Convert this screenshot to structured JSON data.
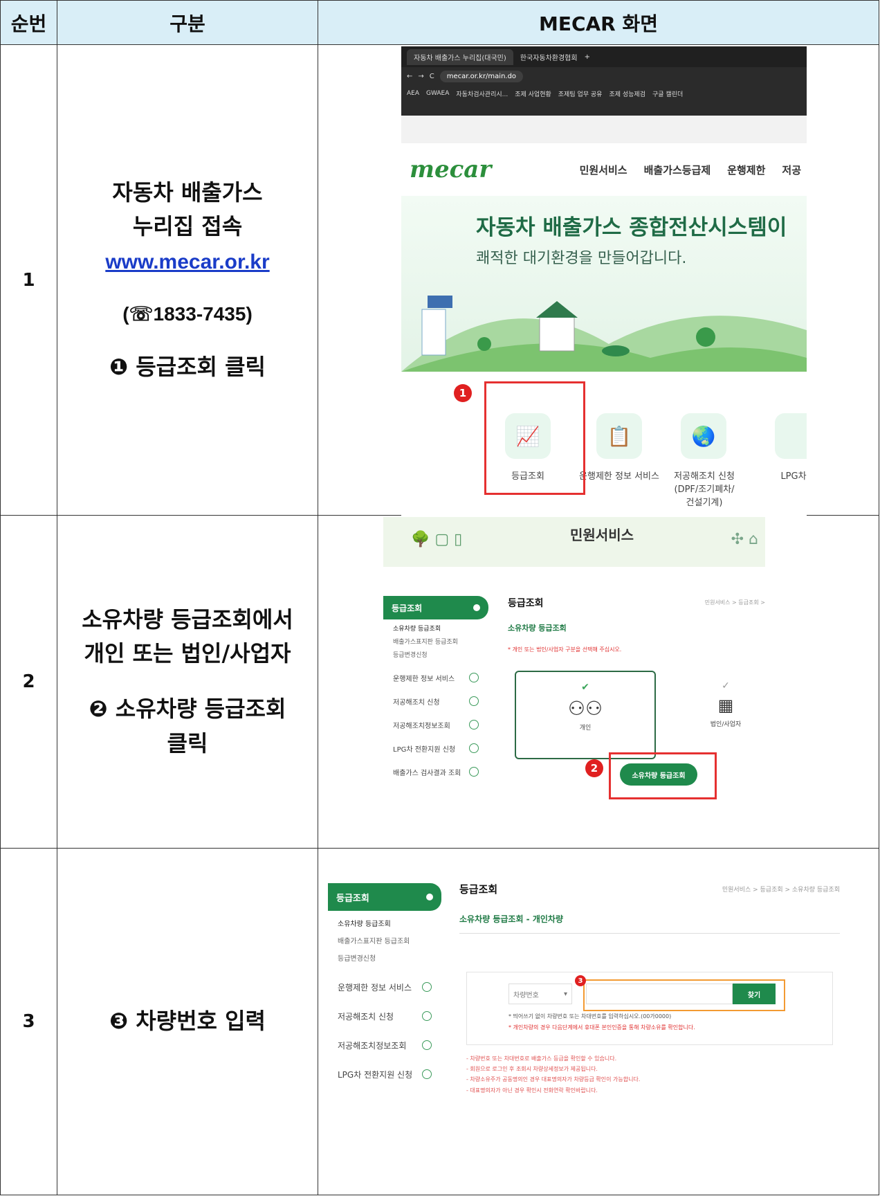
{
  "table": {
    "headers": [
      "순번",
      "구분",
      "MECAR 화면"
    ]
  },
  "rows": [
    {
      "num": "1",
      "line1": "자동차 배출가스",
      "line2": "누리집 접속",
      "link": "www.mecar.or.kr",
      "phone": "(☏1833-7435)",
      "step": "❶ 등급조회 클릭"
    },
    {
      "num": "2",
      "line1": "소유차량 등급조회에서",
      "line2": "개인 또는 법인/사업자",
      "step1": "❷ 소유차량 등급조회",
      "step2": "클릭"
    },
    {
      "num": "3",
      "step": "❸ 차량번호 입력"
    }
  ],
  "shot1": {
    "tab1": "자동차 배출가스 누리집(대국민)",
    "tab2": "한국자동차환경협회",
    "url": "mecar.or.kr/main.do",
    "bookmarks": [
      "AEA",
      "GWAEA",
      "자동차검사관리시...",
      "조제 사업현황",
      "조제팀 업무 공유",
      "조제 성능제검",
      "구글 캘린더"
    ],
    "logo": "mecar",
    "nav": [
      "민원서비스",
      "배출가스등급제",
      "운행제한",
      "저공"
    ],
    "hero_title": "자동차 배출가스 종합전산시스템이",
    "hero_sub": "쾌적한 대기환경을 만들어갑니다.",
    "icons": [
      "등급조회",
      "운행제한 정보 서비스",
      "저공해조치 신청\n(DPF/조기폐차/\n건설기계)",
      "LPG차"
    ],
    "badge": "1"
  },
  "shot2": {
    "banner": "민원서비스",
    "side_head": "등급조회",
    "side_subs": [
      "소유차량 등급조회",
      "배출가스표지판 등급조회",
      "등급변경신청"
    ],
    "side_items": [
      "운행제한 정보 서비스",
      "저공해조치 신청",
      "저공해조치정보조회",
      "LPG차 전환지원 신청",
      "배출가스 검사결과 조회"
    ],
    "title": "등급조회",
    "crumb": "민원서비스 > 등급조회 >",
    "sub": "소유차량 등급조회",
    "note": "* 개인 또는 법인/사업자 구분을 선택해 주십시오.",
    "opt1": "개인",
    "opt2": "법인/사업자",
    "button": "소유차량 등급조회",
    "badge": "2"
  },
  "shot3": {
    "side_head": "등급조회",
    "side_subs": [
      "소유차량 등급조회",
      "배출가스표지판 등급조회",
      "등급변경신청"
    ],
    "side_items": [
      "운행제한 정보 서비스",
      "저공해조치 신청",
      "저공해조치정보조회",
      "LPG차 전환지원 신청"
    ],
    "title": "등급조회",
    "crumb": "민원서비스 > 등급조회 > 소유차량 등급조회",
    "sub": "소유차량 등급조회 - 개인차량",
    "select": "차량번호",
    "button": "찾기",
    "note1": "* 띄어쓰기 없이 차량번호 또는 차대번호를 입력하십시오.(00가0000)",
    "note2": "* 개인차량의 경우 다음단계에서 휴대폰 본인인증을 통해 차량소유를 확인합니다.",
    "bottom": [
      "- 차량번호 또는 차대번호로 배출가스 등급을 확인할 수 있습니다.",
      "- 회원으로 로그인 후 조회시 차량상세정보가 제공됩니다.",
      "- 차량소유주가 공동명의인 경우 대표명의자가 차량등급 확인이 가능합니다.",
      "- 대표명의자가 아닌 경우 확인시 전화연락 확인바랍니다."
    ],
    "badge": "3"
  },
  "colors": {
    "header_bg": "#d9eef7",
    "brand_green": "#1f8a4c",
    "highlight_red": "#e53030",
    "highlight_orange": "#f39a32"
  }
}
